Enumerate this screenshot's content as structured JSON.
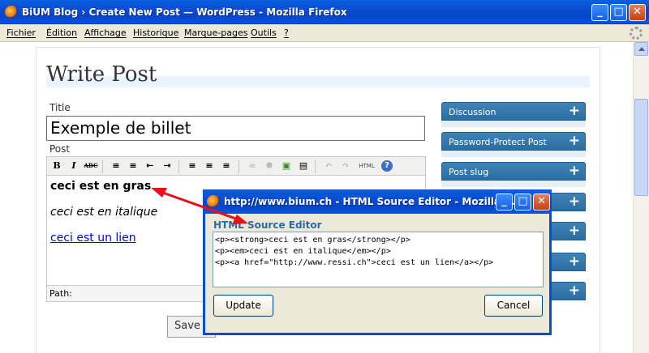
{
  "browser": {
    "window_title": "BiUM Blog › Create New Post — WordPress - Mozilla Firefox",
    "menu": [
      "Fichier",
      "Édition",
      "Affichage",
      "Historique",
      "Marque-pages",
      "Outils",
      "?"
    ],
    "window_buttons": {
      "minimize": "_",
      "maximize": "□",
      "close": "✕"
    }
  },
  "page": {
    "heading": "Write Post",
    "title_label": "Title",
    "title_value": "Exemple de billet",
    "post_label": "Post",
    "toolbar": {
      "bold": "B",
      "italic": "I",
      "strike": "ABC",
      "html": "HTML",
      "help": "?"
    },
    "content": {
      "bold_text": "ceci est en gras",
      "italic_text": "ceci est en italique",
      "link_text": "ceci est un lien"
    },
    "path_label": "Path:",
    "save_label": "Save"
  },
  "sidebar": {
    "boxes": [
      "Discussion",
      "Password-Protect Post",
      "Post slug",
      "",
      "",
      "",
      ""
    ],
    "plus": "+"
  },
  "popup": {
    "window_title": "http://www.bium.ch - HTML Source Editor - Mozilla ...",
    "heading": "HTML Source Editor",
    "source": "<p><strong>ceci est en gras</strong></p>\n<p><em>ceci est en italique</em></p>\n<p><a href=\"http://www.ressi.ch\">ceci est un lien</a></p>",
    "update_label": "Update",
    "cancel_label": "Cancel"
  },
  "colors": {
    "xp_titlebar": "#0b4cd1",
    "sidebar_box": "#3478ad",
    "annotation_arrow": "#e8101a",
    "heading_accent": "#2b6aa8"
  }
}
